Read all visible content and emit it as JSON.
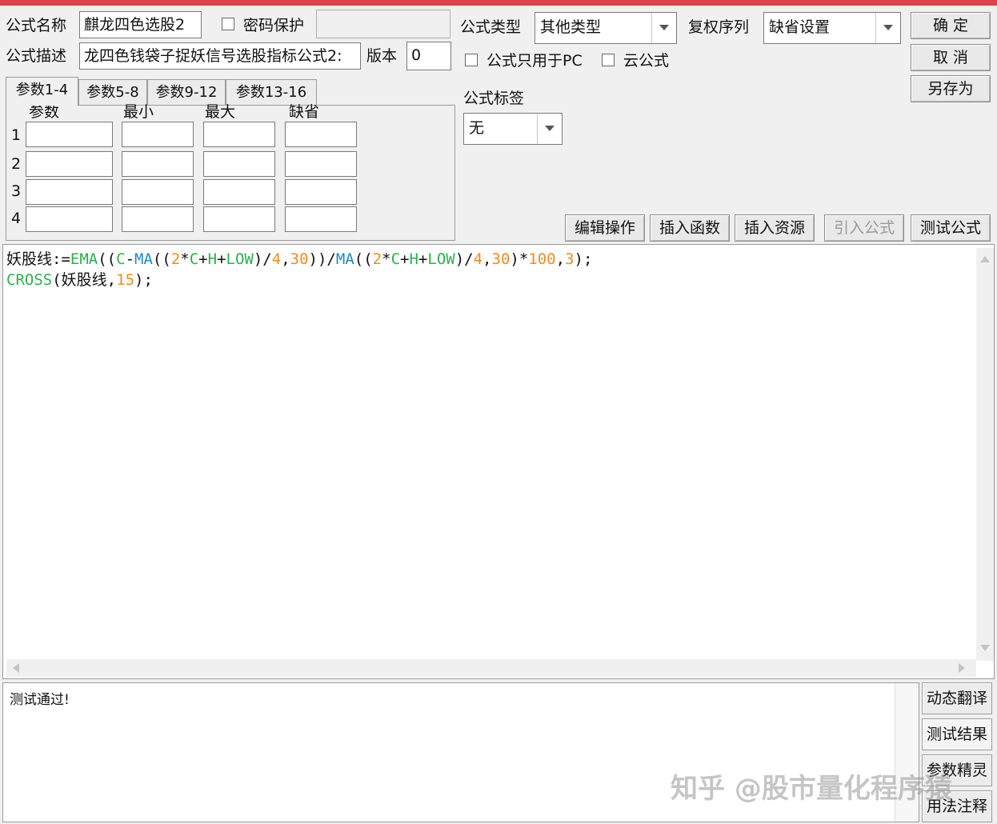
{
  "header": {
    "name_label": "公式名称",
    "name_value": "麒龙四色选股2",
    "password_label": "密码保护",
    "desc_label": "公式描述",
    "desc_value": "龙四色钱袋子捉妖信号选股指标公式2:",
    "version_label": "版本",
    "version_value": "0",
    "type_label": "公式类型",
    "type_value": "其他类型",
    "rights_label": "复权序列",
    "rights_value": "缺省设置",
    "pc_only_label": "公式只用于PC",
    "cloud_label": "云公式",
    "tag_label": "公式标签",
    "tag_value": "无"
  },
  "buttons": {
    "ok": "确  定",
    "cancel": "取  消",
    "save_as": "另存为",
    "edit_ops": "编辑操作",
    "insert_func": "插入函数",
    "insert_res": "插入资源",
    "import_formula": "引入公式",
    "test_formula": "测试公式"
  },
  "param_tabs": [
    "参数1-4",
    "参数5-8",
    "参数9-12",
    "参数13-16"
  ],
  "param_headers": [
    "参数",
    "最小",
    "最大",
    "缺省"
  ],
  "param_rows": [
    "1",
    "2",
    "3",
    "4"
  ],
  "code_lines": [
    [
      {
        "t": "妖股线",
        "c": "#111111"
      },
      {
        "t": ":=",
        "c": "#111111"
      },
      {
        "t": "EMA",
        "c": "#2bb14a"
      },
      {
        "t": "((",
        "c": "#111111"
      },
      {
        "t": "C",
        "c": "#2bb14a"
      },
      {
        "t": "-",
        "c": "#111111"
      },
      {
        "t": "MA",
        "c": "#1e88c8"
      },
      {
        "t": "((",
        "c": "#111111"
      },
      {
        "t": "2",
        "c": "#f08c1e"
      },
      {
        "t": "*",
        "c": "#111111"
      },
      {
        "t": "C",
        "c": "#2bb14a"
      },
      {
        "t": "+",
        "c": "#111111"
      },
      {
        "t": "H",
        "c": "#2bb14a"
      },
      {
        "t": "+",
        "c": "#111111"
      },
      {
        "t": "LOW",
        "c": "#2bb14a"
      },
      {
        "t": ")/",
        "c": "#111111"
      },
      {
        "t": "4",
        "c": "#f08c1e"
      },
      {
        "t": ",",
        "c": "#111111"
      },
      {
        "t": "30",
        "c": "#f08c1e"
      },
      {
        "t": "))/",
        "c": "#111111"
      },
      {
        "t": "MA",
        "c": "#1e88c8"
      },
      {
        "t": "((",
        "c": "#111111"
      },
      {
        "t": "2",
        "c": "#f08c1e"
      },
      {
        "t": "*",
        "c": "#111111"
      },
      {
        "t": "C",
        "c": "#2bb14a"
      },
      {
        "t": "+",
        "c": "#111111"
      },
      {
        "t": "H",
        "c": "#2bb14a"
      },
      {
        "t": "+",
        "c": "#111111"
      },
      {
        "t": "LOW",
        "c": "#2bb14a"
      },
      {
        "t": ")/",
        "c": "#111111"
      },
      {
        "t": "4",
        "c": "#f08c1e"
      },
      {
        "t": ",",
        "c": "#111111"
      },
      {
        "t": "30",
        "c": "#f08c1e"
      },
      {
        "t": ")*",
        "c": "#111111"
      },
      {
        "t": "100",
        "c": "#f08c1e"
      },
      {
        "t": ",",
        "c": "#111111"
      },
      {
        "t": "3",
        "c": "#f08c1e"
      },
      {
        "t": ");",
        "c": "#111111"
      }
    ],
    [
      {
        "t": "CROSS",
        "c": "#2bb14a"
      },
      {
        "t": "(",
        "c": "#111111"
      },
      {
        "t": "妖股线",
        "c": "#111111"
      },
      {
        "t": ",",
        "c": "#111111"
      },
      {
        "t": "15",
        "c": "#f08c1e"
      },
      {
        "t": ");",
        "c": "#111111"
      }
    ]
  ],
  "output_text": "测试通过!",
  "side_buttons": [
    "动态翻译",
    "测试结果",
    "参数精灵",
    "用法注释"
  ],
  "watermark": "知乎 @股市量化程序猿",
  "colors": {
    "title_bar": "#d9434b"
  }
}
